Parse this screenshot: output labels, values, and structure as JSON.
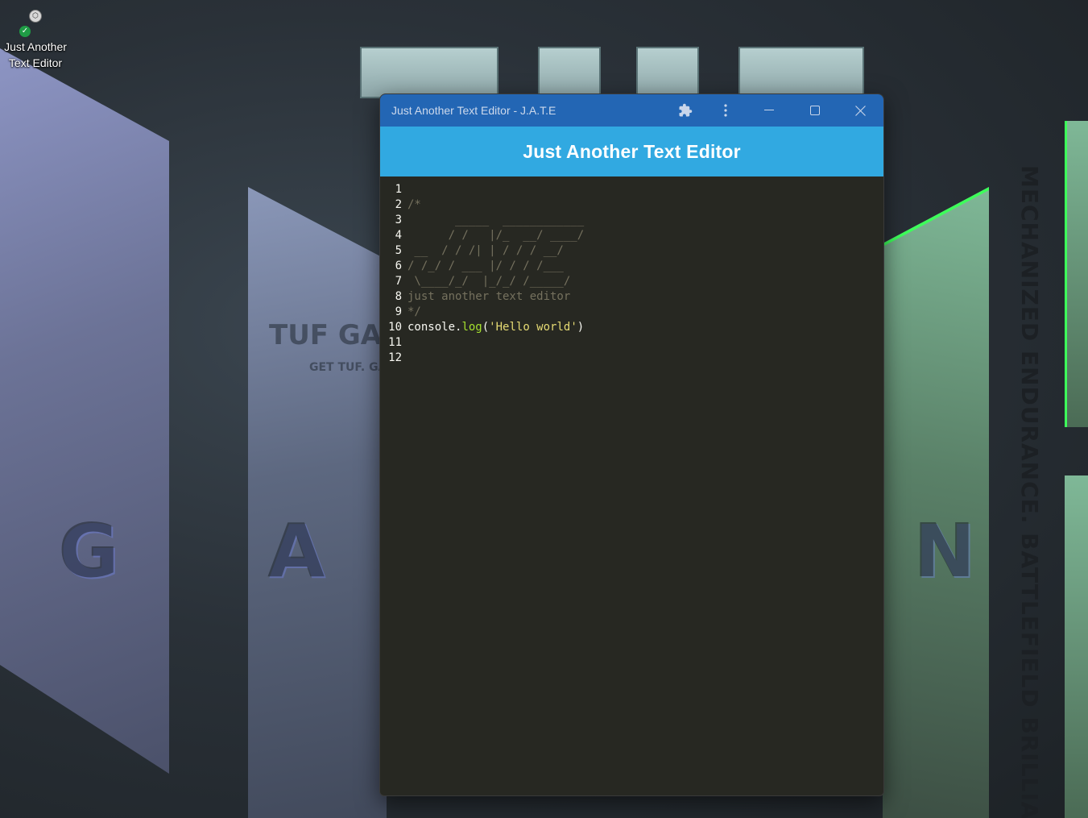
{
  "desktop": {
    "icon": {
      "label_line1": "Just Another",
      "label_line2": "Text Editor"
    },
    "wallpaper": {
      "letters": [
        "G",
        "A",
        "N"
      ],
      "brand_text": "TUF GAM",
      "brand_subtext": "GET TUF. GAME",
      "vertical_slogan": "MECHANIZED ENDURANCE. BATTLEFIELD BRILLIANCE"
    }
  },
  "window": {
    "title": "Just Another Text Editor - J.A.T.E",
    "buttons": {
      "extensions": "puzzle-icon",
      "menu": "more-vert-icon",
      "minimize": "minimize-icon",
      "maximize": "maximize-icon",
      "close": "close-icon"
    },
    "colors": {
      "titlebar": "#2366b4",
      "header": "#31a9e1",
      "editor_bg": "#272822"
    }
  },
  "app": {
    "header_title": "Just Another Text Editor"
  },
  "editor": {
    "line_numbers": [
      "1",
      "2",
      "3",
      "4",
      "5",
      "6",
      "7",
      "8",
      "9",
      "10",
      "11",
      "12"
    ],
    "lines": [
      [],
      [
        {
          "t": "comment",
          "v": "/*"
        }
      ],
      [
        {
          "t": "comment",
          "v": "       _____  ____________"
        }
      ],
      [
        {
          "t": "comment",
          "v": "      / /   |/_  __/ ____/"
        }
      ],
      [
        {
          "t": "comment",
          "v": " __  / / /| | / / / __/"
        }
      ],
      [
        {
          "t": "comment",
          "v": "/ /_/ / ___ |/ / / /___"
        }
      ],
      [
        {
          "t": "comment",
          "v": " \\____/_/  |_/_/ /_____/"
        }
      ],
      [
        {
          "t": "comment",
          "v": "just another text editor"
        }
      ],
      [
        {
          "t": "comment",
          "v": "*/"
        }
      ],
      [
        {
          "t": "plain",
          "v": "console."
        },
        {
          "t": "fn",
          "v": "log"
        },
        {
          "t": "plain",
          "v": "("
        },
        {
          "t": "str",
          "v": "'Hello world'"
        },
        {
          "t": "plain",
          "v": ")"
        }
      ],
      [],
      []
    ]
  }
}
